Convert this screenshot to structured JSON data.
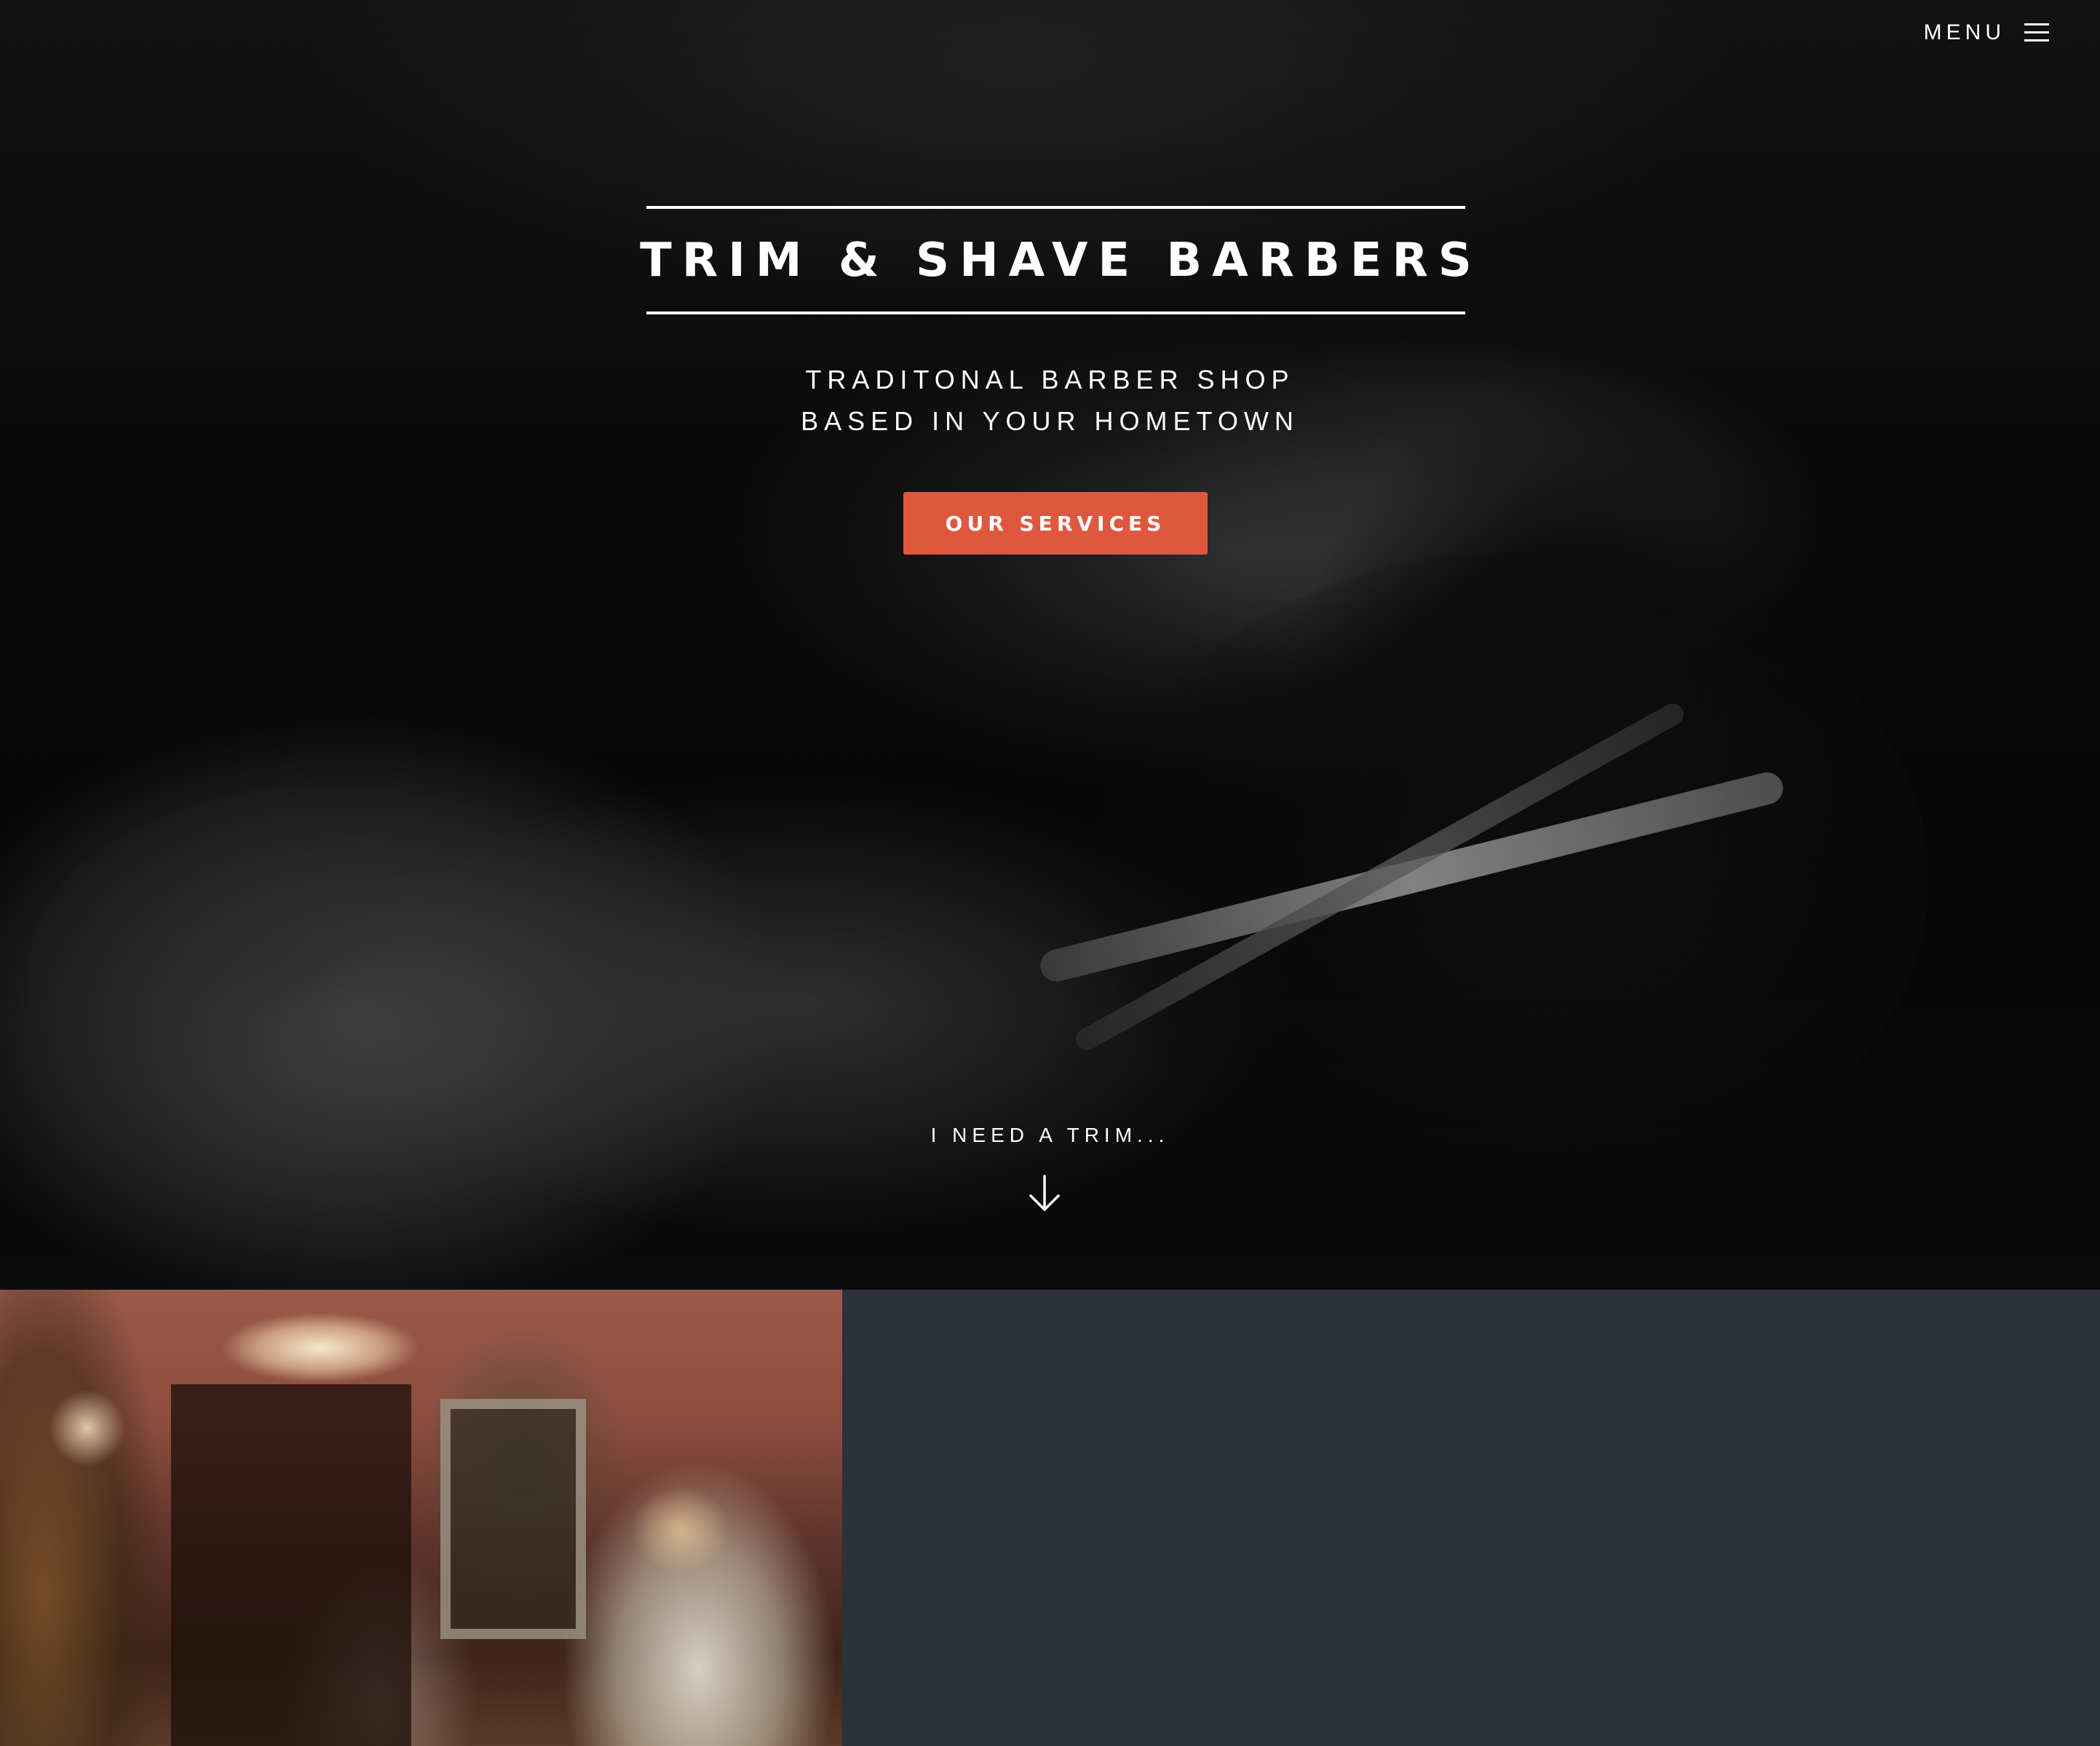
{
  "nav": {
    "menu_label": "MENU",
    "menu_icon": "hamburger-icon"
  },
  "hero": {
    "title": "TRIM & SHAVE BARBERS",
    "tagline_line1": "TRADITONAL BARBER SHOP",
    "tagline_line2": "BASED IN YOUR HOMETOWN",
    "cta_label": "OUR SERVICES",
    "scroll_label": "I NEED A TRIM...",
    "scroll_icon": "arrow-down-icon"
  },
  "colors": {
    "accent": "#e05740",
    "panel_background": "#2c313b",
    "text": "#ffffff"
  }
}
